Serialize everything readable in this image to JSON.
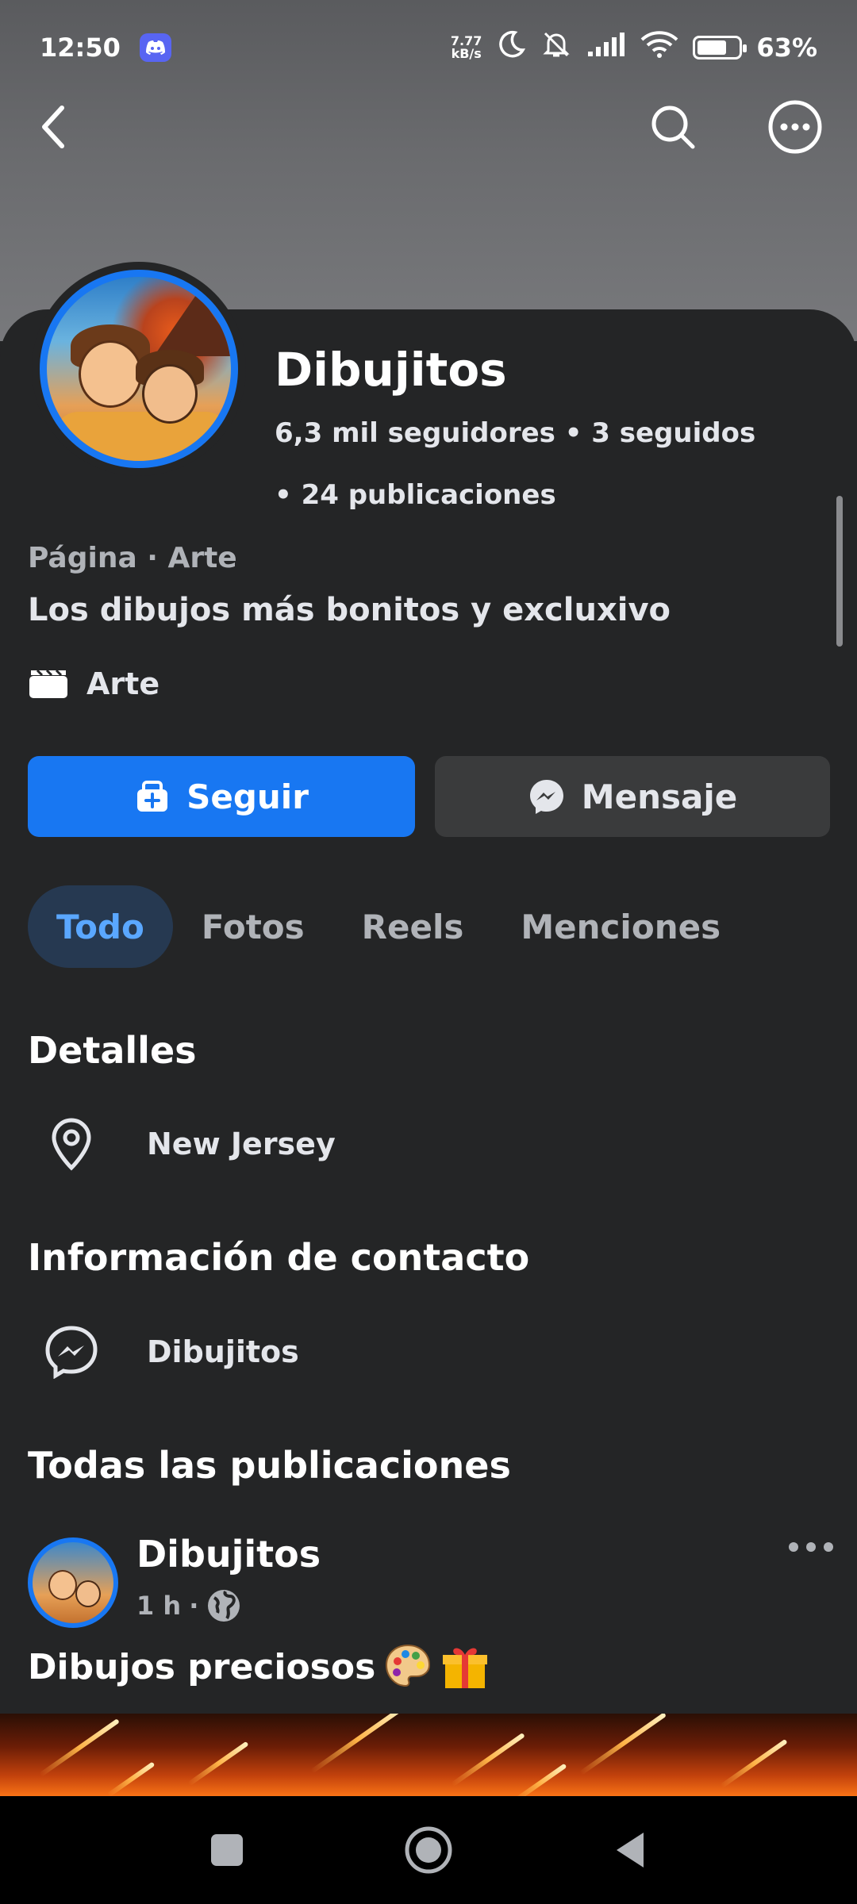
{
  "status_bar": {
    "time": "12:50",
    "net_speed_value": "7.77",
    "net_speed_unit": "kB/s",
    "battery": "63%",
    "battery_level": 0.63
  },
  "profile": {
    "name": "Dibujitos",
    "stats_line1": "6,3  mil seguidores • 3 seguidos",
    "stats_line2": "• 24 publicaciones",
    "category": "Página · Arte",
    "bio": "Los dibujos más bonitos y excluxivo",
    "tag": "Arte"
  },
  "actions": {
    "follow_label": "Seguir",
    "message_label": "Mensaje"
  },
  "tabs": [
    {
      "label": "Todo",
      "active": true
    },
    {
      "label": "Fotos",
      "active": false
    },
    {
      "label": "Reels",
      "active": false
    },
    {
      "label": "Menciones",
      "active": false
    }
  ],
  "details": {
    "title": "Detalles",
    "location": "New Jersey"
  },
  "contact": {
    "title": "Información de contacto",
    "messenger": "Dibujitos"
  },
  "posts": {
    "title": "Todas las publicaciones",
    "items": [
      {
        "author": "Dibujitos",
        "time": "1 h",
        "separator": "·",
        "text": "Dibujos preciosos",
        "emojis": [
          "palette",
          "gift"
        ]
      }
    ]
  },
  "colors": {
    "accent": "#1877f2",
    "background": "#242526",
    "button_secondary": "#3a3b3c",
    "tab_active_bg": "#263951",
    "tab_active_text": "#5aa7ff"
  }
}
